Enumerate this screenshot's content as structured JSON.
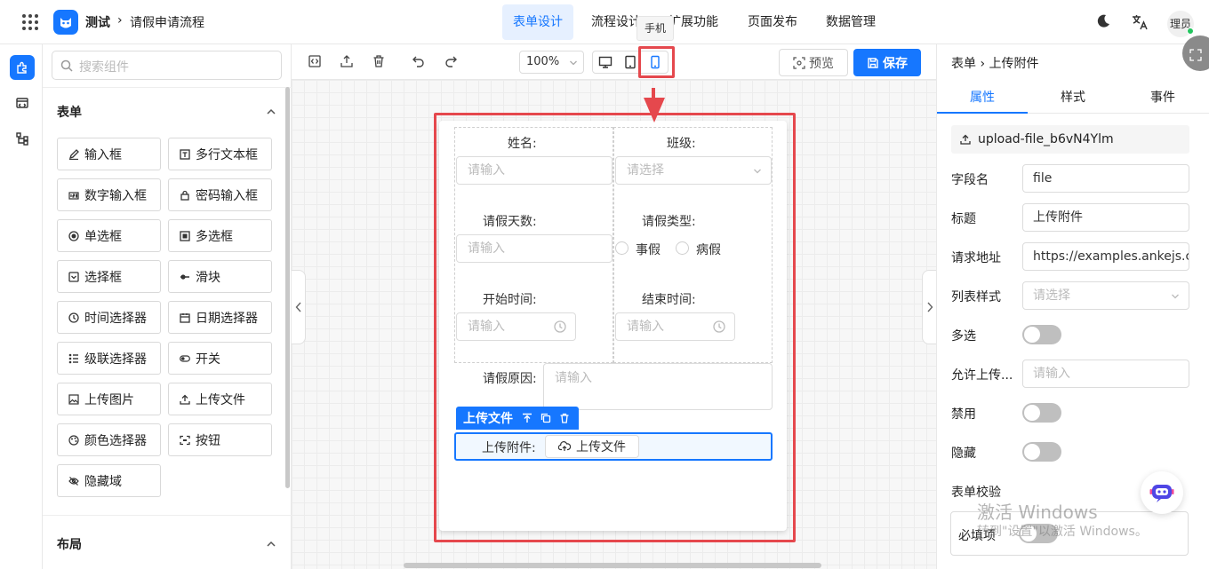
{
  "header": {
    "app_name": "测试",
    "breadcrumb_sep": "›",
    "breadcrumb": "请假申请流程",
    "tabs": [
      {
        "label": "表单设计",
        "active": true
      },
      {
        "label": "流程设计"
      },
      {
        "label": "扩展功能"
      },
      {
        "label": "页面发布"
      },
      {
        "label": "数据管理"
      }
    ],
    "tooltip": "手机",
    "user": "理员"
  },
  "components": {
    "search_placeholder": "搜索组件",
    "section_form": "表单",
    "items": [
      {
        "label": "输入框",
        "icon": "edit-icon"
      },
      {
        "label": "多行文本框",
        "icon": "textarea-icon"
      },
      {
        "label": "数字输入框",
        "icon": "number-icon"
      },
      {
        "label": "密码输入框",
        "icon": "lock-icon"
      },
      {
        "label": "单选框",
        "icon": "radio-icon"
      },
      {
        "label": "多选框",
        "icon": "checkbox-icon"
      },
      {
        "label": "选择框",
        "icon": "select-icon"
      },
      {
        "label": "滑块",
        "icon": "slider-icon"
      },
      {
        "label": "时间选择器",
        "icon": "clock-icon"
      },
      {
        "label": "日期选择器",
        "icon": "calendar-icon"
      },
      {
        "label": "级联选择器",
        "icon": "cascader-icon"
      },
      {
        "label": "开关",
        "icon": "switch-icon"
      },
      {
        "label": "上传图片",
        "icon": "image-icon"
      },
      {
        "label": "上传文件",
        "icon": "upload-icon"
      },
      {
        "label": "颜色选择器",
        "icon": "palette-icon"
      },
      {
        "label": "按钮",
        "icon": "button-icon"
      },
      {
        "label": "隐藏域",
        "icon": "eye-off-icon"
      }
    ],
    "section_layout": "布局"
  },
  "toolbar": {
    "zoom": "100%",
    "preview": "预览",
    "save": "保存"
  },
  "form": {
    "name_label": "姓名:",
    "name_placeholder": "请输入",
    "class_label": "班级:",
    "class_placeholder": "请选择",
    "days_label": "请假天数:",
    "days_placeholder": "请输入",
    "type_label": "请假类型:",
    "type_options": [
      "事假",
      "病假"
    ],
    "start_label": "开始时间:",
    "start_placeholder": "请输入",
    "end_label": "结束时间:",
    "end_placeholder": "请输入",
    "reason_label": "请假原因:",
    "reason_placeholder": "请输入",
    "selected_tag": "上传文件",
    "upload_label": "上传附件:",
    "upload_button": "上传文件"
  },
  "props": {
    "crumb": "表单 › 上传附件",
    "tabs": [
      "属性",
      "样式",
      "事件"
    ],
    "component_id": "upload-file_b6vN4Ylm",
    "field_name_label": "字段名",
    "field_name": "file",
    "title_label": "标题",
    "title": "上传附件",
    "url_label": "请求地址",
    "url": "https://examples.ankejs.cn/",
    "list_style_label": "列表样式",
    "list_style_placeholder": "请选择",
    "multiple_label": "多选",
    "allow_label": "允许上传...",
    "allow_placeholder": "请输入",
    "disabled_label": "禁用",
    "hidden_label": "隐藏",
    "validate_label": "表单校验",
    "required_label": "必填项"
  },
  "watermark": {
    "line1": "激活 Windows",
    "line2": "转到\"设置\"以激活 Windows。"
  },
  "colors": {
    "primary": "#1677ff",
    "highlight": "#e5484d"
  }
}
